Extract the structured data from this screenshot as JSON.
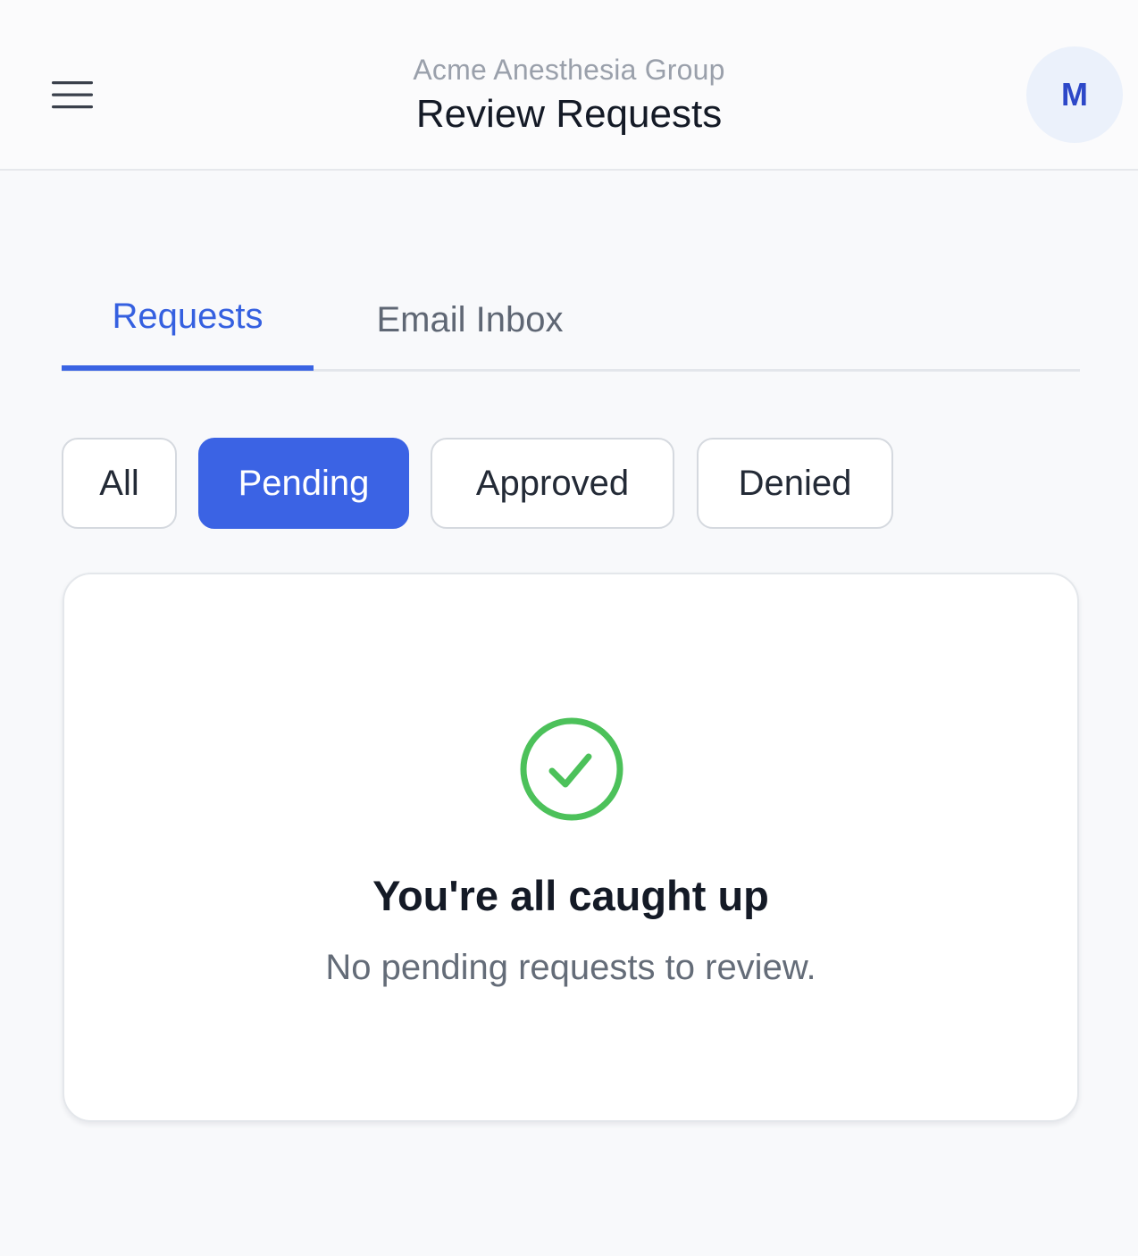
{
  "header": {
    "org_name": "Acme Anesthesia Group",
    "title": "Review Requests",
    "menu_icon": "hamburger-menu-icon",
    "avatar_initial": "M"
  },
  "tabs": [
    {
      "label": "Requests",
      "active": true
    },
    {
      "label": "Email Inbox",
      "active": false
    }
  ],
  "filters": [
    {
      "label": "All",
      "active": false
    },
    {
      "label": "Pending",
      "active": true
    },
    {
      "label": "Approved",
      "active": false
    },
    {
      "label": "Denied",
      "active": false
    }
  ],
  "empty_state": {
    "icon": "check-circle-icon",
    "title": "You're all caught up",
    "subtitle": "No pending requests to review."
  },
  "colors": {
    "accent": "#3b63e4",
    "success": "#4cc15a",
    "background": "#f8f9fb",
    "avatar_bg": "#ebf1fb",
    "avatar_text": "#2d48c8"
  }
}
